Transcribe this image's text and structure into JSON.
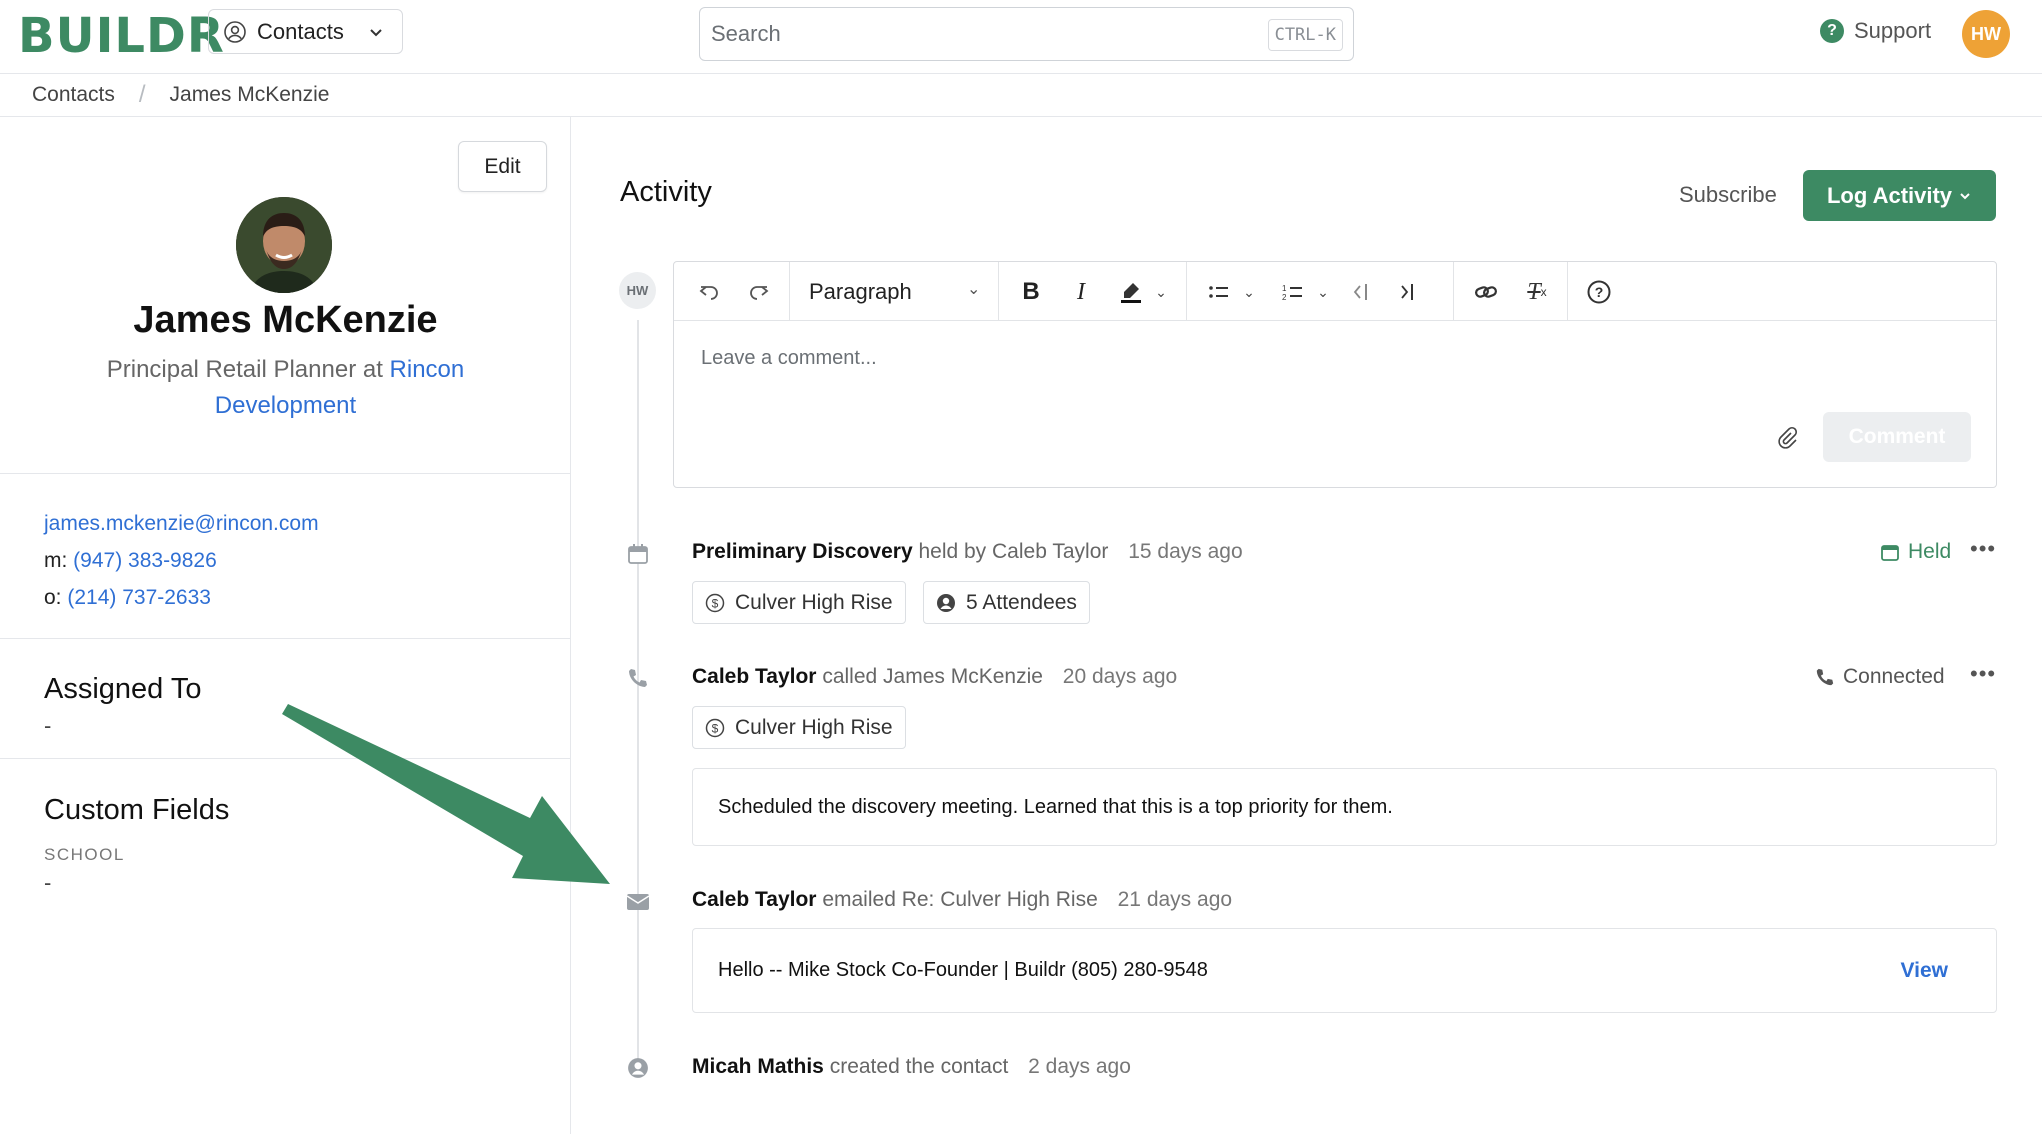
{
  "app": {
    "logo": "BUILDR",
    "workspace": "Contacts",
    "search_placeholder": "Search",
    "search_shortcut": "CTRL-K",
    "support": "Support",
    "user_initials": "HW"
  },
  "breadcrumb": [
    "Contacts",
    "James McKenzie"
  ],
  "contact": {
    "edit": "Edit",
    "name": "James McKenzie",
    "title": "Principal Retail Planner at",
    "company": "Rincon Development",
    "email": "james.mckenzie@rincon.com",
    "mobile_label": "m:",
    "mobile": "(947) 383-9826",
    "office_label": "o:",
    "office": "(214) 737-2633",
    "assigned_to_title": "Assigned To",
    "assigned_to": "-",
    "custom_fields_title": "Custom Fields",
    "school_label": "SCHOOL",
    "school": "-"
  },
  "activity": {
    "title": "Activity",
    "subscribe": "Subscribe",
    "log_activity": "Log Activity",
    "avatar": "HW",
    "editor": {
      "paragraph": "Paragraph",
      "placeholder": "Leave a comment...",
      "comment": "Comment"
    },
    "events": [
      {
        "actor": "Preliminary Discovery",
        "verb": "held by Caleb Taylor",
        "ago": "15 days ago",
        "status": "Held",
        "status_color": "#3d8a63",
        "chips": [
          "Culver High Rise",
          "5 Attendees"
        ]
      },
      {
        "actor": "Caleb Taylor",
        "verb": "called James McKenzie",
        "ago": "20 days ago",
        "status": "Connected",
        "status_color": "#555555",
        "chips": [
          "Culver High Rise"
        ],
        "note": "Scheduled the discovery meeting. Learned that this is a top priority for them."
      },
      {
        "actor": "Caleb Taylor",
        "verb": "emailed Re: Culver High Rise",
        "ago": "21 days ago",
        "preview": "Hello -- Mike Stock Co-Founder | Buildr (805) 280-9548",
        "view": "View"
      },
      {
        "actor": "Micah Mathis",
        "verb": "created the contact",
        "ago": "2 days ago"
      }
    ]
  },
  "colors": {
    "brand": "#3d8a63",
    "link": "#2f6fd4",
    "avatar": "#eea236"
  }
}
